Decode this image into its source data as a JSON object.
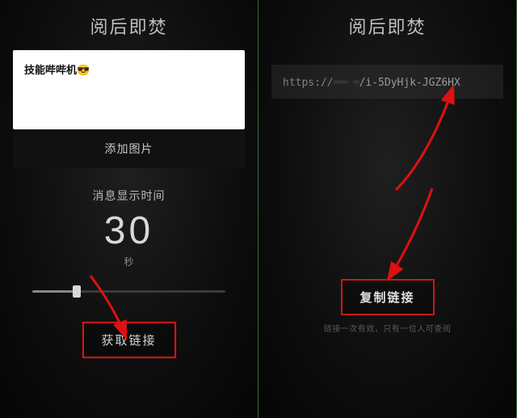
{
  "left": {
    "title": "阅后即焚",
    "message_text": "技能哔哔机😎",
    "add_image_label": "添加图片",
    "timer_label": "消息显示时间",
    "timer_value": "30",
    "timer_unit": "秒",
    "get_link_label": "获取链接"
  },
  "right": {
    "title": "阅后即焚",
    "url_prefix": "https://",
    "url_obscured": "ꞏꞏꞏꞏꞏ ꞏꞏ",
    "url_tail": "/i-5DyHjk-JGZ6HX",
    "copy_link_label": "复制链接",
    "footnote": "链接一次有效，只有一位人可查阅"
  }
}
